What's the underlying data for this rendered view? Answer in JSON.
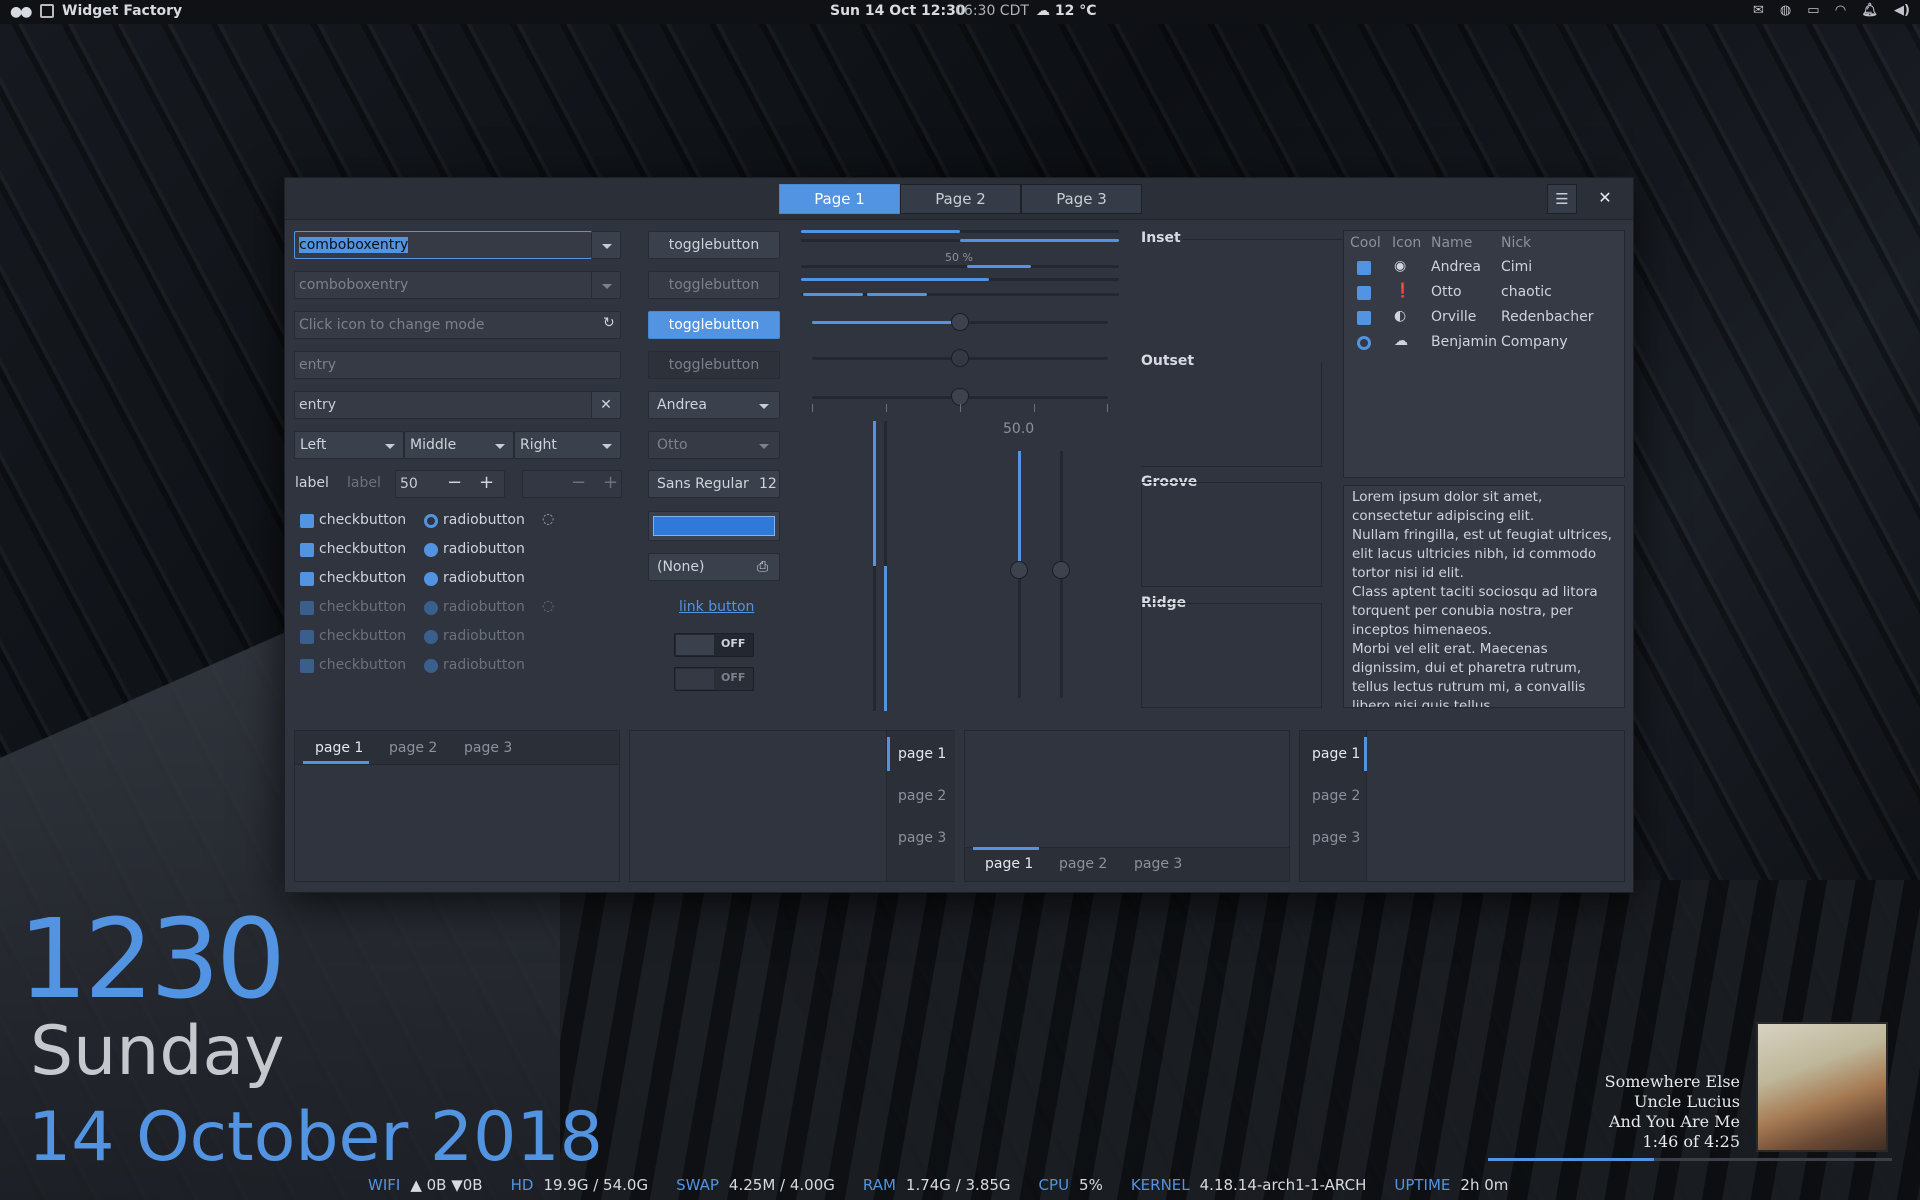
{
  "topbar": {
    "app_name": "Widget Factory",
    "datetime": "Sun 14 Oct  12:30",
    "alt_time": "06:30 CDT",
    "weather": "12 °C"
  },
  "window": {
    "tabs": [
      "Page 1",
      "Page 2",
      "Page 3"
    ],
    "col1": {
      "combo1": "comboboxentry",
      "combo2": "comboboxentry",
      "mode_entry_placeholder": "Click icon to change mode",
      "entry1_placeholder": "entry",
      "entry2": "entry",
      "combos": [
        "Left",
        "Middle",
        "Right"
      ],
      "label1": "label",
      "label2": "label",
      "spin_value": "50",
      "check_label": "checkbutton",
      "radio_label": "radiobutton"
    },
    "col2": {
      "toggle": "togglebutton",
      "combo_andrea": "Andrea",
      "combo_otto": "Otto",
      "font_name": "Sans Regular",
      "font_size": "12",
      "file": "(None)",
      "link": "link button",
      "switch_off": "OFF"
    },
    "col3": {
      "progress_label": "50 %",
      "scale_value": "50.0"
    },
    "frames": [
      "Inset",
      "Outset",
      "Groove",
      "Ridge"
    ],
    "tree": {
      "headers": [
        "Cool",
        "Icon",
        "Name",
        "Nick"
      ],
      "rows": [
        {
          "name": "Andrea",
          "nick": "Cimi"
        },
        {
          "name": "Otto",
          "nick": "chaotic"
        },
        {
          "name": "Orville",
          "nick": "Redenbacher"
        },
        {
          "name": "Benjamin",
          "nick": "Company"
        }
      ]
    },
    "textview": [
      "Lorem ipsum dolor sit amet,",
      "consectetur adipiscing elit.",
      "Nullam fringilla, est ut feugiat ultrices,",
      "elit lacus ultricies nibh, id commodo",
      "tortor nisi id elit.",
      "Class aptent taciti sociosqu ad litora",
      "torquent per conubia nostra, per",
      "inceptos himenaeos.",
      "Morbi vel elit erat. Maecenas",
      "dignissim, dui et pharetra rutrum,",
      "tellus lectus rutrum mi, a convallis",
      "libero nisi quis tellus."
    ],
    "notebook_tabs": [
      "page 1",
      "page 2",
      "page 3"
    ]
  },
  "desktop": {
    "clock": "1230",
    "day": "Sunday",
    "date": "14 October 2018",
    "music": {
      "title": "Somewhere Else",
      "artist": "Uncle Lucius",
      "album": "And You Are Me",
      "time": "1:46 of 4:25",
      "progress": 0.41
    },
    "stats": [
      {
        "k": "WIFI",
        "v": "▲ 0B  ▼0B"
      },
      {
        "k": "HD",
        "v": "19.9G / 54.0G"
      },
      {
        "k": "SWAP",
        "v": "4.25M / 4.00G"
      },
      {
        "k": "RAM",
        "v": "1.74G / 3.85G"
      },
      {
        "k": "CPU",
        "v": "5%"
      },
      {
        "k": "KERNEL",
        "v": "4.18.14-arch1-1-ARCH"
      },
      {
        "k": "UPTIME",
        "v": "2h 0m"
      }
    ]
  },
  "colors": {
    "accent": "#5294e2",
    "window_bg": "#2f343f",
    "panel": "#0f1114"
  }
}
